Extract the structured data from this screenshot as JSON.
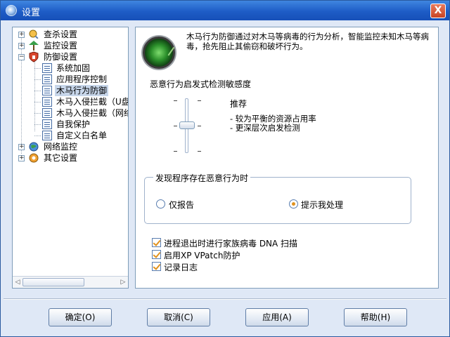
{
  "window": {
    "title": "设置",
    "close_glyph": "X"
  },
  "tree": {
    "items": [
      {
        "label": "查杀设置",
        "expander": "+",
        "icon": "scan-icon"
      },
      {
        "label": "监控设置",
        "expander": "+",
        "icon": "monitor-icon"
      },
      {
        "label": "防御设置",
        "expander": "−",
        "icon": "shield-icon"
      },
      {
        "label": "系统加固",
        "icon": "page-icon"
      },
      {
        "label": "应用程序控制",
        "icon": "page-icon"
      },
      {
        "label": "木马行为防御",
        "icon": "page-icon",
        "selected": true
      },
      {
        "label": "木马入侵拦截（U盘",
        "icon": "page-icon"
      },
      {
        "label": "木马入侵拦截（网络",
        "icon": "page-icon"
      },
      {
        "label": "自我保护",
        "icon": "page-icon"
      },
      {
        "label": "自定义白名单",
        "icon": "page-icon"
      },
      {
        "label": "网络监控",
        "expander": "+",
        "icon": "globe-icon"
      },
      {
        "label": "其它设置",
        "expander": "+",
        "icon": "gear-icon"
      }
    ]
  },
  "panel": {
    "description": "木马行为防御通过对木马等病毒的行为分析，智能监控未知木马等病毒，抢先阻止其偷窃和破坏行为。",
    "sensitivity_title": "恶意行为启发式检测敏感度",
    "level_label": "推荐",
    "level_desc_1": "- 较为平衡的资源占用率",
    "level_desc_2": "- 更深层次启发检测",
    "slider_level": 0.5,
    "group_title": "发现程序存在恶意行为时",
    "radio_report": "仅报告",
    "radio_prompt": "提示我处理",
    "radio_selected": "prompt",
    "check_dna": "进程退出时进行家族病毒 DNA 扫描",
    "check_vpatch": "启用XP VPatch防护",
    "check_log": "记录日志"
  },
  "buttons": {
    "ok": "确定(O)",
    "cancel": "取消(C)",
    "apply": "应用(A)",
    "help": "帮助(H)"
  },
  "colors": {
    "accent": "#1e5cc6",
    "radio_dot": "#e0921f",
    "panel_bg": "#dfe8f6"
  }
}
